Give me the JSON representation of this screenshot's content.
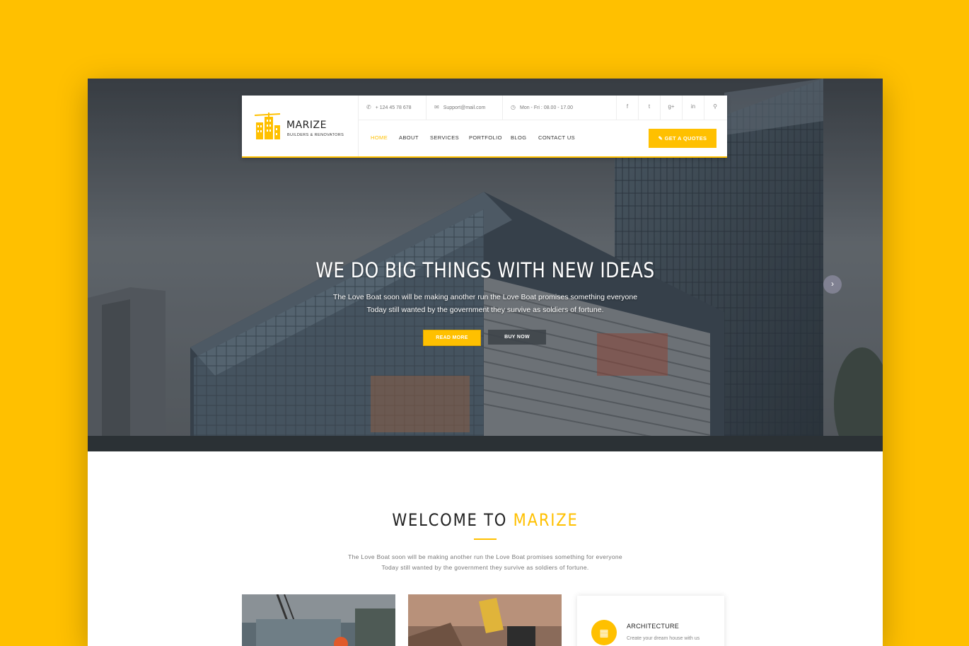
{
  "brand": {
    "name": "MARIZE",
    "tagline": "BUILDERS & RENOVATORS",
    "accent_color": "#FFC000"
  },
  "topbar": {
    "phone": "+ 124 45 78 678",
    "email": "Support@mail.com",
    "hours": "Mon - Fri : 08.00 - 17.00",
    "phone_icon": "phone-icon",
    "email_icon": "envelope-icon",
    "hours_icon": "clock-icon",
    "social": [
      "f",
      "t",
      "g+",
      "in"
    ]
  },
  "nav": {
    "items": [
      "HOME",
      "ABOUT",
      "SERVICES",
      "PORTFOLIO",
      "BLOG",
      "CONTACT US"
    ],
    "active": "HOME",
    "quote_button": "GET A QUOTES"
  },
  "hero": {
    "title": "WE DO BIG THINGS WITH NEW IDEAS",
    "subtitle_line1": "The Love Boat soon will be making another run the Love Boat promises something everyone",
    "subtitle_line2": "Today still wanted by the government they survive as soldiers of fortune.",
    "read_more": "READ MORE",
    "buy_now": "BUY NOW"
  },
  "welcome": {
    "title_prefix": "WELCOME TO",
    "title_accent": "MARIZE",
    "text_line1": "The Love Boat soon will be making another run the Love Boat promises something for everyone",
    "text_line2": "Today still wanted by the government they survive as soldiers of fortune."
  },
  "service": {
    "title": "ARCHITECTURE",
    "text": "Create your dream house with us"
  }
}
